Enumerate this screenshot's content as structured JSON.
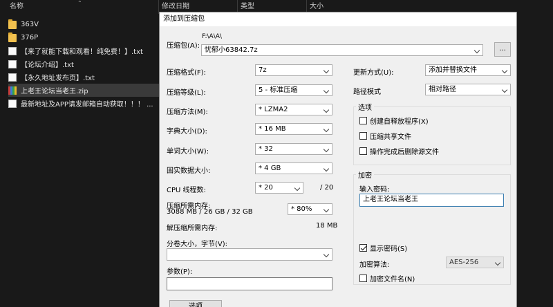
{
  "explorer": {
    "columns": {
      "name": "名称",
      "modified": "修改日期",
      "type": "类型",
      "size": "大小"
    },
    "files": [
      {
        "name": "363V",
        "kind": "folder"
      },
      {
        "name": "376P",
        "kind": "folder"
      },
      {
        "name": "【来了就能下载和观看！纯免费！】.txt",
        "kind": "txt"
      },
      {
        "name": "【论坛介绍】.txt",
        "kind": "txt"
      },
      {
        "name": "【永久地址发布页】.txt",
        "kind": "txt"
      },
      {
        "name": "上老王论坛当老王.zip",
        "kind": "zip"
      },
      {
        "name": "最新地址及APP请发邮箱自动获取！！！ ...",
        "kind": "txt"
      }
    ]
  },
  "dialog": {
    "title": "添加到压缩包",
    "archive_label": "压缩包(A):",
    "archive_path": "F:\\A\\A\\",
    "archive_name": "忧郁小63842.7z",
    "browse_label": "...",
    "format_label": "压缩格式(F):",
    "format_value": "7z",
    "level_label": "压缩等级(L):",
    "level_value": "5 - 标准压缩",
    "method_label": "压缩方法(M):",
    "method_value": "* LZMA2",
    "dict_label": "字典大小(D):",
    "dict_value": "* 16 MB",
    "word_label": "单词大小(W):",
    "word_value": "* 32",
    "solid_label": "固实数据大小:",
    "solid_value": "* 4 GB",
    "cpu_label": "CPU 线程数:",
    "cpu_value": "* 20",
    "cpu_total": "/ 20",
    "mem_label": "压缩所需内存:",
    "mem_detail": "3088 MB / 26 GB / 32 GB",
    "mem_value": "* 80%",
    "decomp_label": "解压缩所需内存:",
    "decomp_value": "18 MB",
    "split_label": "分卷大小，字节(V):",
    "split_value": "",
    "params_label": "参数(P):",
    "params_value": "",
    "options_button": "选项",
    "update_label": "更新方式(U):",
    "update_value": "添加并替换文件",
    "path_label": "路径模式",
    "path_value": "相对路径",
    "options_group": "选项",
    "opt_sfx": "创建自释放程序(X)",
    "opt_shared": "压缩共享文件",
    "opt_delete": "操作完成后删除源文件",
    "enc_group": "加密",
    "pwd_label": "输入密码:",
    "pwd_value": "上老王论坛当老王",
    "show_pwd": "显示密码(S)",
    "enc_method_label": "加密算法:",
    "enc_method_value": "AES-256",
    "enc_names": "加密文件名(N)"
  }
}
